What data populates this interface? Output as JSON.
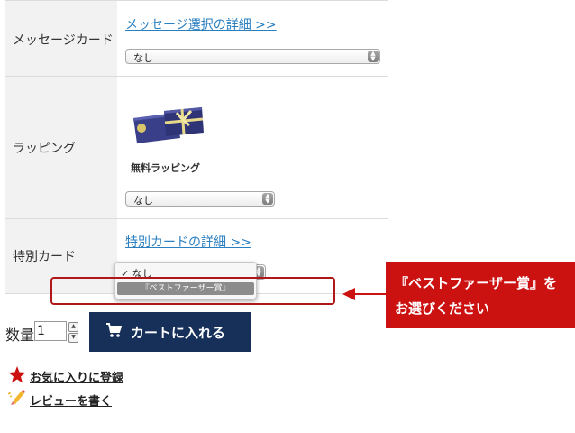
{
  "message_card": {
    "label": "メッセージカード",
    "detail_link": "メッセージ選択の詳細 >>",
    "select_value": "なし"
  },
  "wrapping": {
    "label": "ラッピング",
    "product_name": "無料ラッピング",
    "select_value": "なし"
  },
  "special_card": {
    "label": "特別カード",
    "detail_link": "特別カードの詳細 >>",
    "options": [
      "なし",
      "『ベストファーザー賞』"
    ],
    "checkmark": "✓"
  },
  "callout": {
    "line1": "『ベストファーザー賞』を",
    "line2": "お選びください"
  },
  "quantity": {
    "label": "数量",
    "value": "1"
  },
  "cart_button": {
    "label": "カートに入れる"
  },
  "favorite_link": "お気に入りに登録",
  "review_link": "レビューを書く",
  "colors": {
    "accent_red": "#cc1111",
    "cart_blue": "#17305a",
    "link_blue": "#2a7fc0"
  }
}
